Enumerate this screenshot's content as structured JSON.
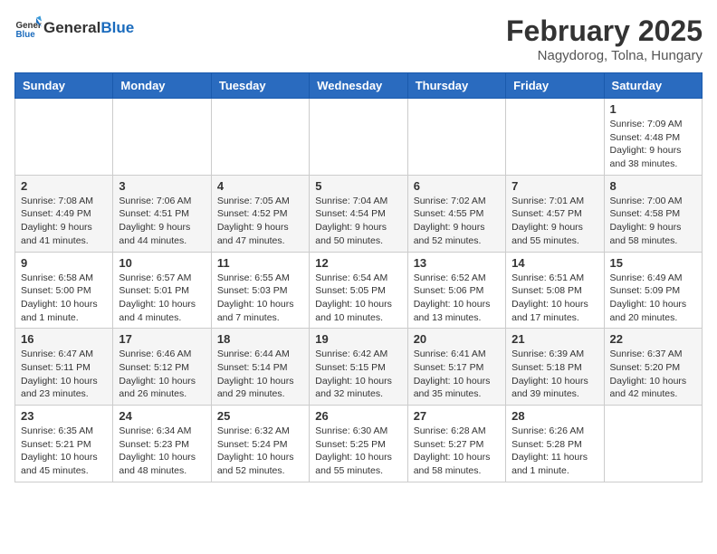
{
  "header": {
    "logo_general": "General",
    "logo_blue": "Blue",
    "month": "February 2025",
    "location": "Nagydorog, Tolna, Hungary"
  },
  "days_of_week": [
    "Sunday",
    "Monday",
    "Tuesday",
    "Wednesday",
    "Thursday",
    "Friday",
    "Saturday"
  ],
  "weeks": [
    [
      {
        "day": "",
        "info": ""
      },
      {
        "day": "",
        "info": ""
      },
      {
        "day": "",
        "info": ""
      },
      {
        "day": "",
        "info": ""
      },
      {
        "day": "",
        "info": ""
      },
      {
        "day": "",
        "info": ""
      },
      {
        "day": "1",
        "info": "Sunrise: 7:09 AM\nSunset: 4:48 PM\nDaylight: 9 hours and 38 minutes."
      }
    ],
    [
      {
        "day": "2",
        "info": "Sunrise: 7:08 AM\nSunset: 4:49 PM\nDaylight: 9 hours and 41 minutes."
      },
      {
        "day": "3",
        "info": "Sunrise: 7:06 AM\nSunset: 4:51 PM\nDaylight: 9 hours and 44 minutes."
      },
      {
        "day": "4",
        "info": "Sunrise: 7:05 AM\nSunset: 4:52 PM\nDaylight: 9 hours and 47 minutes."
      },
      {
        "day": "5",
        "info": "Sunrise: 7:04 AM\nSunset: 4:54 PM\nDaylight: 9 hours and 50 minutes."
      },
      {
        "day": "6",
        "info": "Sunrise: 7:02 AM\nSunset: 4:55 PM\nDaylight: 9 hours and 52 minutes."
      },
      {
        "day": "7",
        "info": "Sunrise: 7:01 AM\nSunset: 4:57 PM\nDaylight: 9 hours and 55 minutes."
      },
      {
        "day": "8",
        "info": "Sunrise: 7:00 AM\nSunset: 4:58 PM\nDaylight: 9 hours and 58 minutes."
      }
    ],
    [
      {
        "day": "9",
        "info": "Sunrise: 6:58 AM\nSunset: 5:00 PM\nDaylight: 10 hours and 1 minute."
      },
      {
        "day": "10",
        "info": "Sunrise: 6:57 AM\nSunset: 5:01 PM\nDaylight: 10 hours and 4 minutes."
      },
      {
        "day": "11",
        "info": "Sunrise: 6:55 AM\nSunset: 5:03 PM\nDaylight: 10 hours and 7 minutes."
      },
      {
        "day": "12",
        "info": "Sunrise: 6:54 AM\nSunset: 5:05 PM\nDaylight: 10 hours and 10 minutes."
      },
      {
        "day": "13",
        "info": "Sunrise: 6:52 AM\nSunset: 5:06 PM\nDaylight: 10 hours and 13 minutes."
      },
      {
        "day": "14",
        "info": "Sunrise: 6:51 AM\nSunset: 5:08 PM\nDaylight: 10 hours and 17 minutes."
      },
      {
        "day": "15",
        "info": "Sunrise: 6:49 AM\nSunset: 5:09 PM\nDaylight: 10 hours and 20 minutes."
      }
    ],
    [
      {
        "day": "16",
        "info": "Sunrise: 6:47 AM\nSunset: 5:11 PM\nDaylight: 10 hours and 23 minutes."
      },
      {
        "day": "17",
        "info": "Sunrise: 6:46 AM\nSunset: 5:12 PM\nDaylight: 10 hours and 26 minutes."
      },
      {
        "day": "18",
        "info": "Sunrise: 6:44 AM\nSunset: 5:14 PM\nDaylight: 10 hours and 29 minutes."
      },
      {
        "day": "19",
        "info": "Sunrise: 6:42 AM\nSunset: 5:15 PM\nDaylight: 10 hours and 32 minutes."
      },
      {
        "day": "20",
        "info": "Sunrise: 6:41 AM\nSunset: 5:17 PM\nDaylight: 10 hours and 35 minutes."
      },
      {
        "day": "21",
        "info": "Sunrise: 6:39 AM\nSunset: 5:18 PM\nDaylight: 10 hours and 39 minutes."
      },
      {
        "day": "22",
        "info": "Sunrise: 6:37 AM\nSunset: 5:20 PM\nDaylight: 10 hours and 42 minutes."
      }
    ],
    [
      {
        "day": "23",
        "info": "Sunrise: 6:35 AM\nSunset: 5:21 PM\nDaylight: 10 hours and 45 minutes."
      },
      {
        "day": "24",
        "info": "Sunrise: 6:34 AM\nSunset: 5:23 PM\nDaylight: 10 hours and 48 minutes."
      },
      {
        "day": "25",
        "info": "Sunrise: 6:32 AM\nSunset: 5:24 PM\nDaylight: 10 hours and 52 minutes."
      },
      {
        "day": "26",
        "info": "Sunrise: 6:30 AM\nSunset: 5:25 PM\nDaylight: 10 hours and 55 minutes."
      },
      {
        "day": "27",
        "info": "Sunrise: 6:28 AM\nSunset: 5:27 PM\nDaylight: 10 hours and 58 minutes."
      },
      {
        "day": "28",
        "info": "Sunrise: 6:26 AM\nSunset: 5:28 PM\nDaylight: 11 hours and 1 minute."
      },
      {
        "day": "",
        "info": ""
      }
    ]
  ]
}
